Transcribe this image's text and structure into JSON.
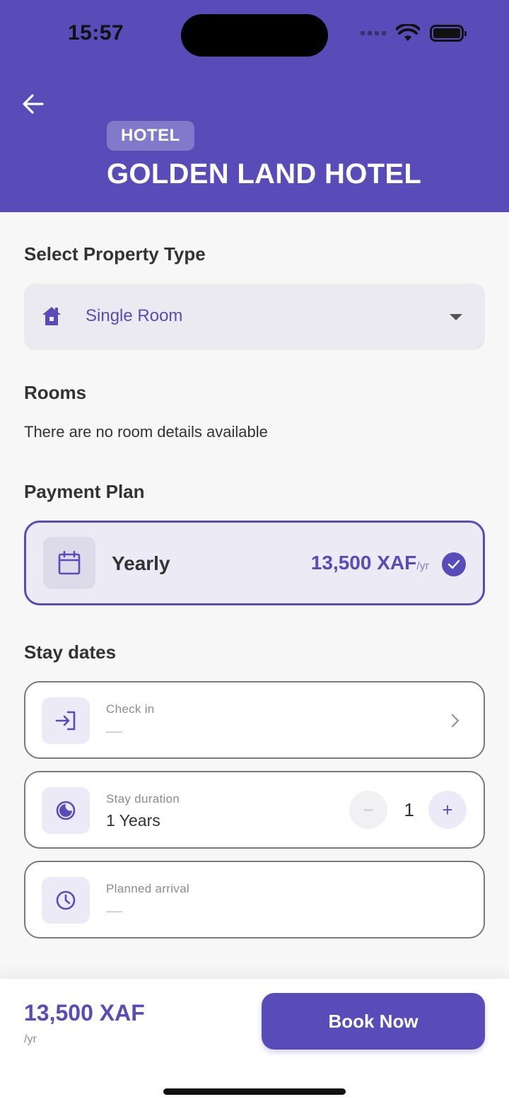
{
  "status_bar": {
    "time": "15:57"
  },
  "header": {
    "category": "HOTEL",
    "title": "GOLDEN LAND HOTEL",
    "background_color": "#594cb8"
  },
  "property_type": {
    "title": "Select Property Type",
    "selected": "Single Room",
    "icon": "house-icon"
  },
  "rooms": {
    "title": "Rooms",
    "empty_text": "There are no room details available"
  },
  "payment_plan": {
    "title": "Payment Plan",
    "plan": {
      "name": "Yearly",
      "price": "13,500 XAF",
      "unit": "/yr",
      "selected": true,
      "icon": "calendar-icon"
    }
  },
  "stay_dates": {
    "title": "Stay dates",
    "check_in": {
      "label": "Check in",
      "value": "—",
      "icon": "sign-in-icon"
    },
    "duration": {
      "label": "Stay duration",
      "value": "1 Years",
      "count": "1",
      "minus": "−",
      "plus": "+",
      "icon": "half-moon-icon"
    },
    "arrival": {
      "label": "Planned arrival",
      "value": "—",
      "icon": "clock-icon"
    }
  },
  "footer": {
    "total": "13,500 XAF",
    "per": "/yr",
    "book_label": "Book Now"
  },
  "colors": {
    "accent": "#594cb8",
    "background": "#f7f7f8"
  }
}
